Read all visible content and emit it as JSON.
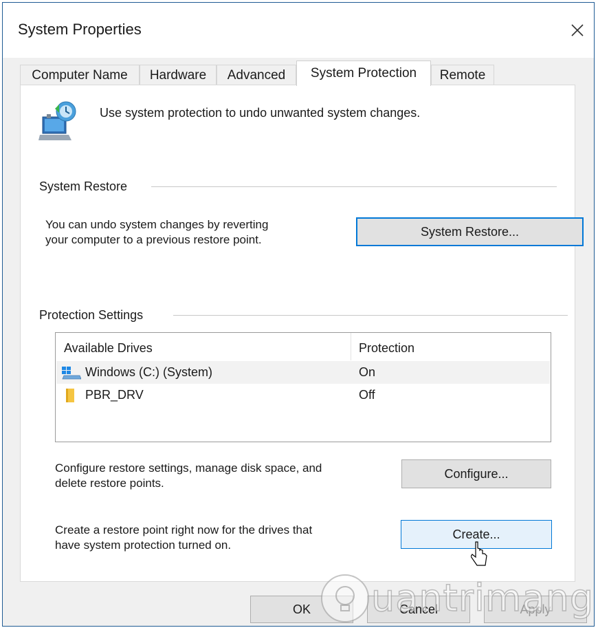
{
  "window": {
    "title": "System Properties"
  },
  "tabs": [
    {
      "label": "Computer Name"
    },
    {
      "label": "Hardware"
    },
    {
      "label": "Advanced"
    },
    {
      "label": "System Protection",
      "active": true
    },
    {
      "label": "Remote"
    }
  ],
  "intro": {
    "text": "Use system protection to undo unwanted system changes.",
    "icon": "system-protection-icon"
  },
  "system_restore": {
    "group_label": "System Restore",
    "description": [
      "You can undo system changes by reverting",
      "your computer to a previous restore point."
    ],
    "button_label": "System Restore..."
  },
  "protection_settings": {
    "group_label": "Protection Settings",
    "columns": [
      "Available Drives",
      "Protection"
    ],
    "drives": [
      {
        "name": "Windows (C:) (System)",
        "protection": "On",
        "icon": "system-drive-icon"
      },
      {
        "name": "PBR_DRV",
        "protection": "Off",
        "icon": "drive-icon"
      }
    ],
    "configure": {
      "description": [
        "Configure restore settings, manage disk space, and",
        "delete restore points."
      ],
      "button_label": "Configure..."
    },
    "create": {
      "description": [
        "Create a restore point right now for the drives that",
        "have system protection turned on."
      ],
      "button_label": "Create..."
    }
  },
  "footer": {
    "ok_label": "OK",
    "cancel_label": "Cancel",
    "apply_label": "Apply"
  },
  "watermark": {
    "text": "uantrimang"
  },
  "colors": {
    "accent": "#0078d7",
    "window_bg": "#f0f0f0",
    "panel_bg": "#ffffff"
  }
}
